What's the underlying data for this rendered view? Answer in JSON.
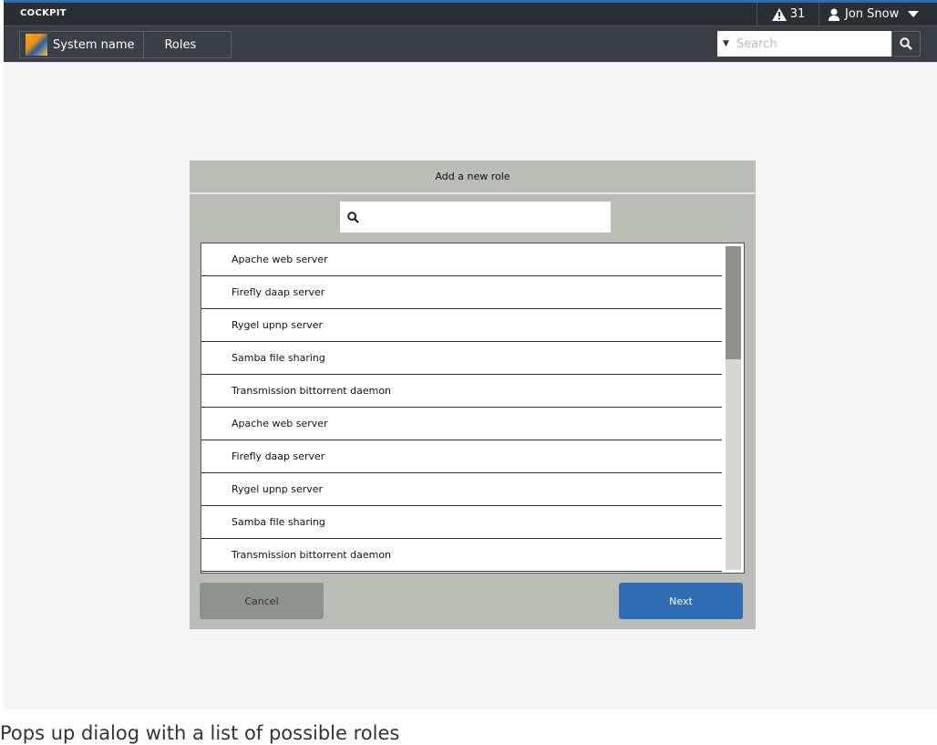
{
  "app": {
    "brand": "COCKPIT"
  },
  "header": {
    "alert_count": "31",
    "user_name": "Jon Snow"
  },
  "nav": {
    "host": "System name",
    "section": "Roles",
    "search_placeholder": "Search"
  },
  "dialog": {
    "title": "Add a new role",
    "filter_placeholder": "",
    "items": [
      "Apache web server",
      "Firefly daap server",
      "Rygel upnp server",
      "Samba file sharing",
      "Transmission bittorrent daemon",
      "Apache web server",
      "Firefly daap server",
      "Rygel upnp server",
      "Samba file sharing",
      "Transmission bittorrent daemon"
    ],
    "cancel_label": "Cancel",
    "next_label": "Next"
  },
  "caption": "Pops up dialog with a list of possible roles",
  "colors": {
    "accent": "#2e6db4",
    "dialog_bg": "#babdb6",
    "topbar": "#2b2f33"
  }
}
